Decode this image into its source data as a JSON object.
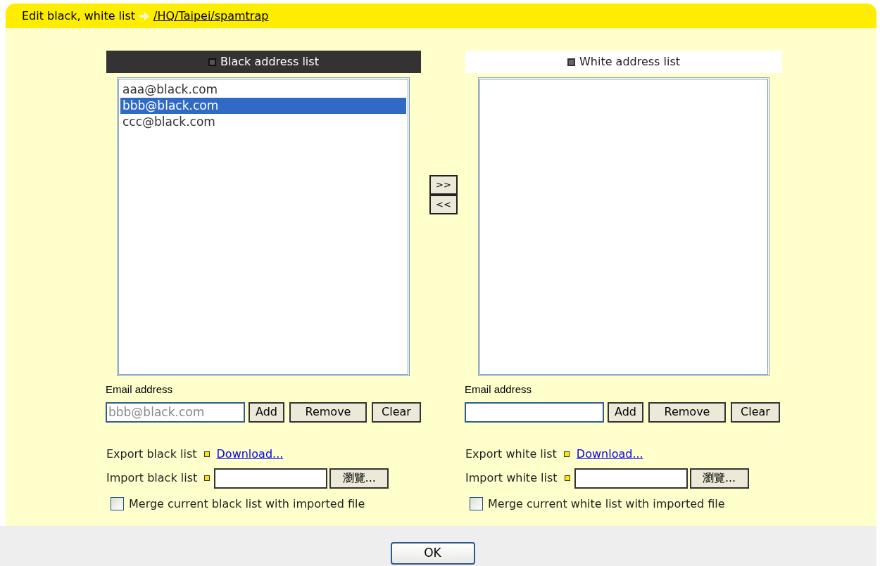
{
  "header": {
    "title": "Edit black, white list",
    "path": "/HQ/Taipei/spamtrap"
  },
  "lists": [
    {
      "kind": "black",
      "title": "Black address list",
      "items": [
        {
          "text": "aaa@black.com",
          "selected": false
        },
        {
          "text": "bbb@black.com",
          "selected": true
        },
        {
          "text": "ccc@black.com",
          "selected": false
        }
      ],
      "email_label": "Email address",
      "email_placeholder": "bbb@black.com",
      "buttons": [
        "Add",
        "Remove",
        "Clear"
      ],
      "export_label": "Export black list",
      "download_link": "Download...",
      "import_label": "Import black list",
      "browse_button": "瀏覽...",
      "merge": {
        "label": "Merge current black list with imported file",
        "checked": false
      }
    },
    {
      "kind": "white",
      "title": "White address list",
      "email_label": "Email address",
      "buttons": [
        "Add",
        "Remove",
        "Clear"
      ],
      "export_label": "Export white list",
      "download_link": "Download...",
      "import_label": "Import white list",
      "browse_button": "瀏覽...",
      "merge": {
        "label": "Merge current white list with imported file",
        "checked": false
      }
    }
  ],
  "move_buttons": [
    ">>",
    "<<"
  ],
  "ok_button": "OK"
}
